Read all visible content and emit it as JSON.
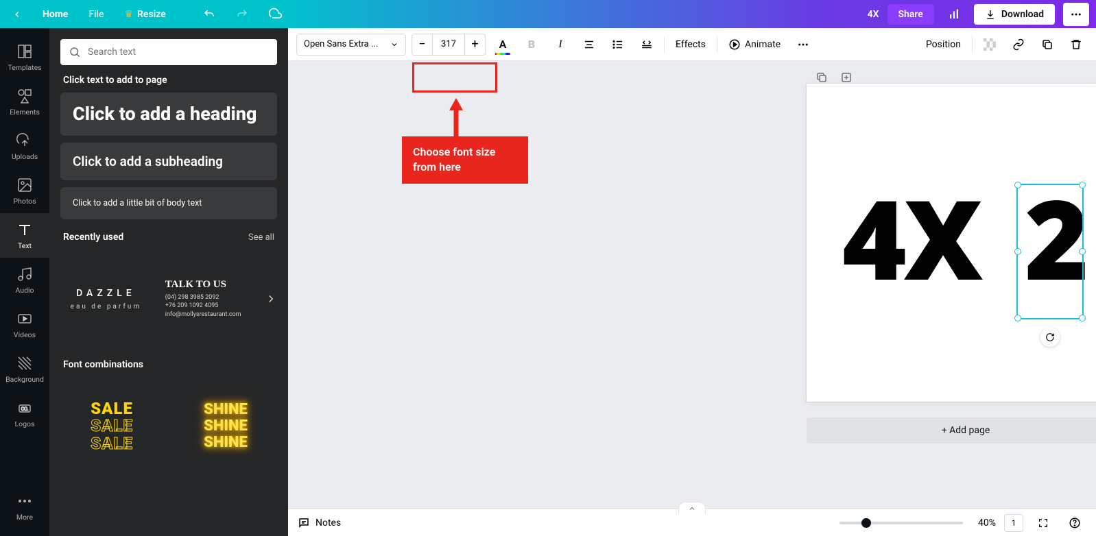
{
  "header": {
    "home": "Home",
    "file": "File",
    "resize": "Resize",
    "doc_title": "4X",
    "share": "Share",
    "download": "Download"
  },
  "rail": {
    "templates": "Templates",
    "elements": "Elements",
    "uploads": "Uploads",
    "photos": "Photos",
    "text": "Text",
    "audio": "Audio",
    "videos": "Videos",
    "background": "Background",
    "logos": "Logos",
    "more": "More"
  },
  "side": {
    "search_placeholder": "Search text",
    "hint": "Click text to add to page",
    "heading": "Click to add a heading",
    "subheading": "Click to add a subheading",
    "body": "Click to add a little bit of body text",
    "recently": "Recently used",
    "see_all": "See all",
    "dazzle_1": "DAZZLE",
    "dazzle_2": "eau de parfum",
    "talk_1": "TALK TO US",
    "talk_2a": "(04) 298 3985 2092",
    "talk_2b": "+76 209 1092 4095",
    "talk_2c": "info@mollysrestaurant.com",
    "font_combos": "Font combinations",
    "sale": "SALE",
    "shine": "SHINE"
  },
  "toolbar": {
    "font": "Open Sans Extra ...",
    "size": "317",
    "effects": "Effects",
    "animate": "Animate",
    "position": "Position"
  },
  "canvas": {
    "t1": "4X",
    "t2": "2",
    "add_page": "+ Add page"
  },
  "annotation": {
    "label": "Choose font size from here"
  },
  "bottom": {
    "notes": "Notes",
    "zoom": "40%",
    "pages": "1"
  }
}
